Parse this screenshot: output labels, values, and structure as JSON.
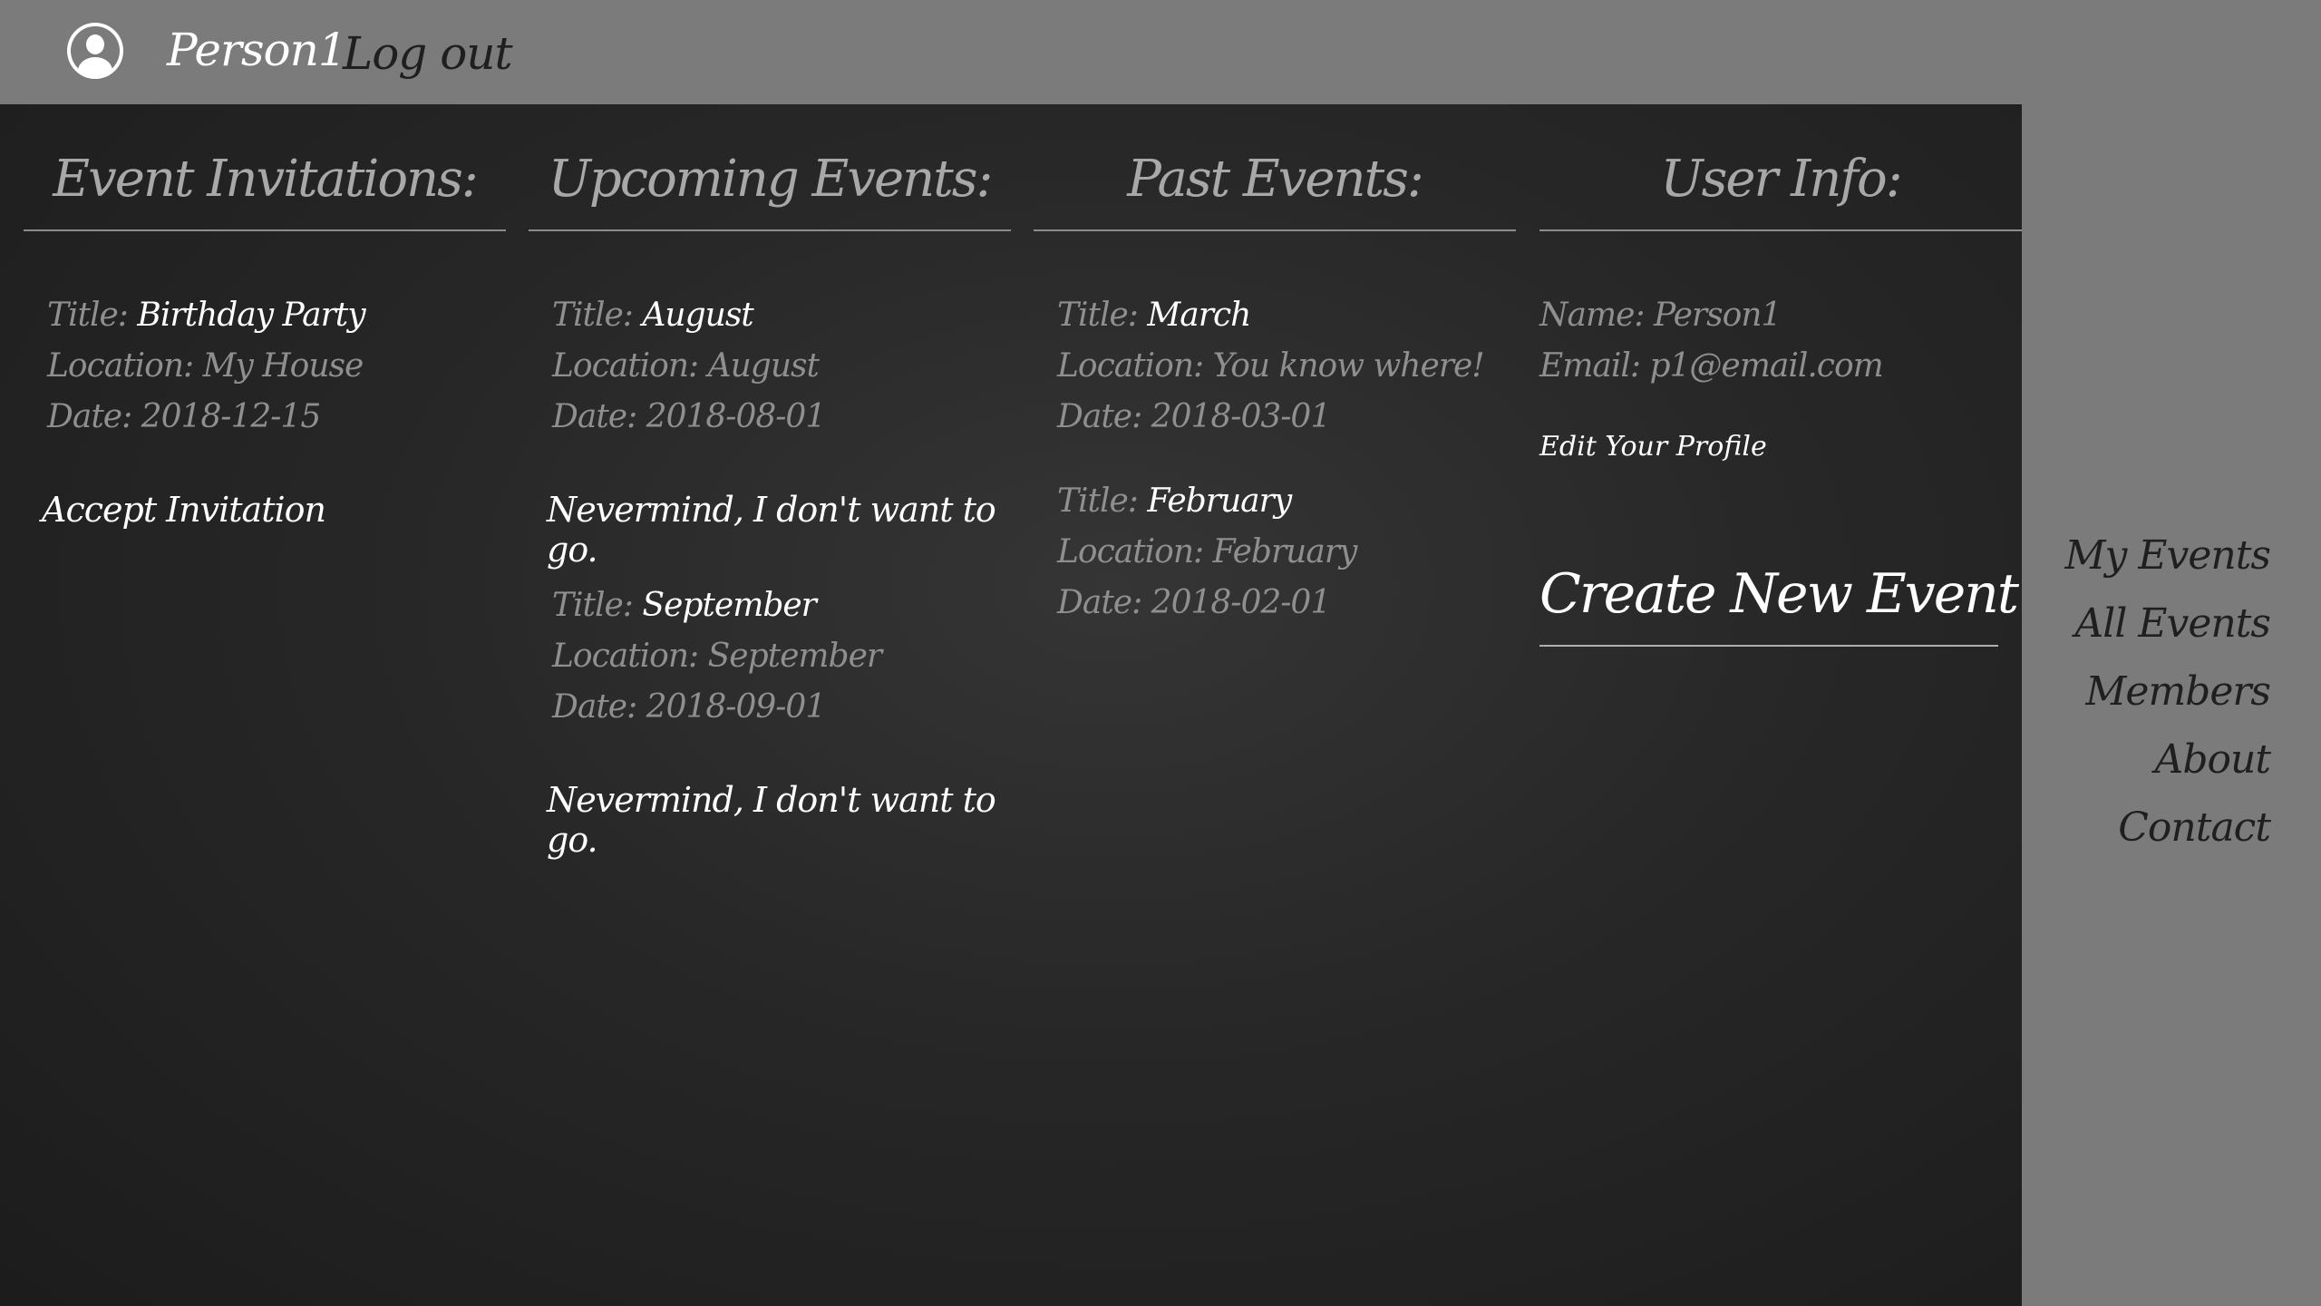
{
  "header": {
    "username": "Person1",
    "logout_label": "Log out"
  },
  "invitations": {
    "heading": "Event Invitations:",
    "events": [
      {
        "title_label": "Title:",
        "title": "Birthday Party",
        "location": "Location: My House",
        "date": "Date: 2018-12-15",
        "action": "Accept Invitation"
      }
    ]
  },
  "upcoming": {
    "heading": "Upcoming Events:",
    "events": [
      {
        "title_label": "Title:",
        "title": "August",
        "location": "Location: August",
        "date": "Date: 2018-08-01",
        "action": "Nevermind, I don't want to go."
      },
      {
        "title_label": "Title:",
        "title": "September",
        "location": "Location: September",
        "date": "Date: 2018-09-01",
        "action": "Nevermind, I don't want to go."
      }
    ]
  },
  "past": {
    "heading": "Past Events:",
    "events": [
      {
        "title_label": "Title:",
        "title": "March",
        "location": "Location: You know where!",
        "date": "Date: 2018-03-01"
      },
      {
        "title_label": "Title:",
        "title": "February",
        "location": "Location: February",
        "date": "Date: 2018-02-01"
      }
    ]
  },
  "user_info": {
    "heading": "User Info:",
    "name": "Name: Person1",
    "email": "Email: p1@email.com",
    "edit_profile": "Edit Your Profile",
    "create_event": "Create New Event"
  },
  "sidenav": {
    "items": [
      "My Events",
      "All Events",
      "Members",
      "About",
      "Contact"
    ]
  },
  "colors": {
    "topbar": "#7b7b7b",
    "panel": "#272727",
    "accent_text": "#ffffff",
    "muted_text": "#8f8f8f"
  }
}
